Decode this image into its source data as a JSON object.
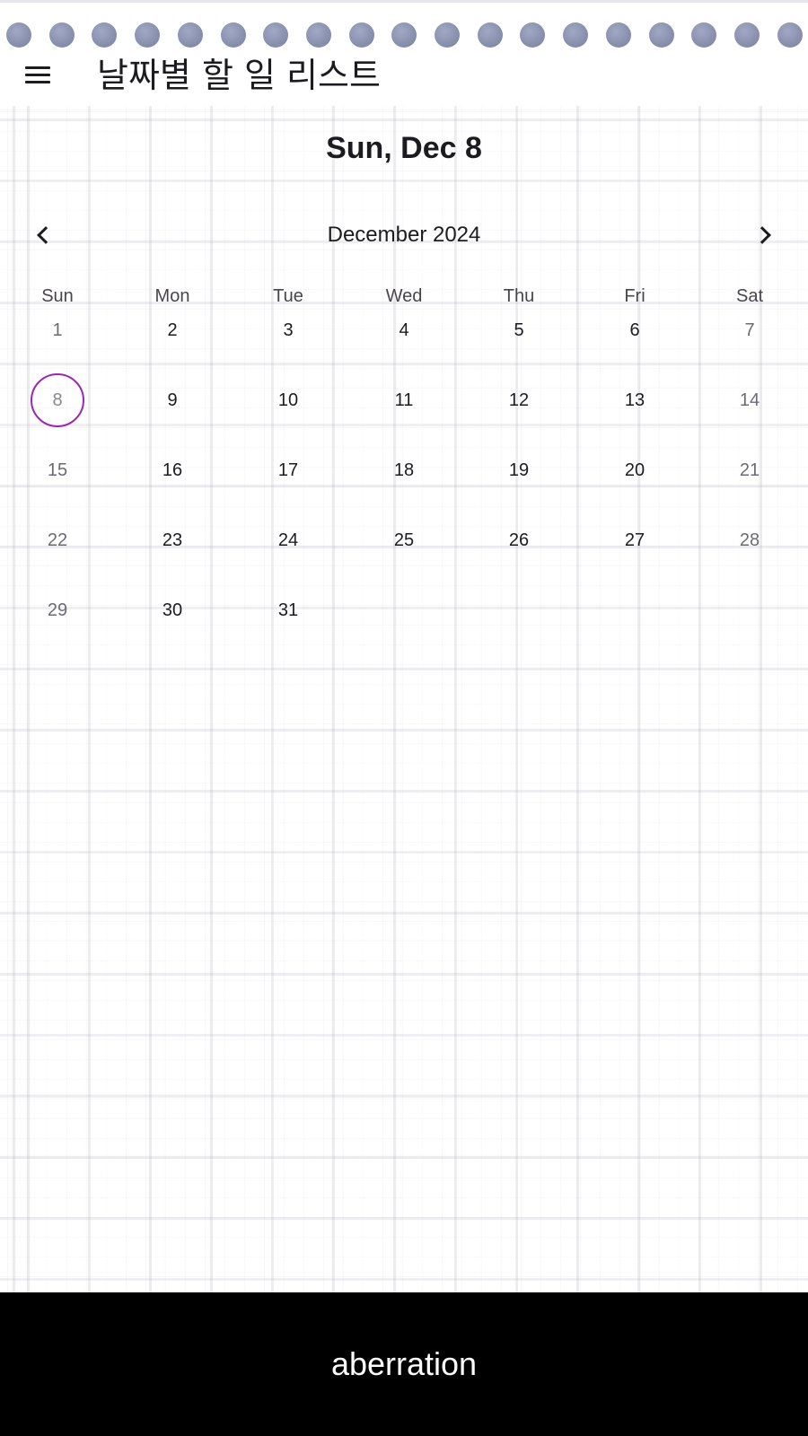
{
  "app_bar": {
    "title": "날짜별 할 일 리스트",
    "menu_icon": "menu-icon"
  },
  "calendar": {
    "selected_date_header": "Sun, Dec 8",
    "month_label": "December 2024",
    "prev_icon": "chevron-left-icon",
    "next_icon": "chevron-right-icon",
    "weekdays": [
      "Sun",
      "Mon",
      "Tue",
      "Wed",
      "Thu",
      "Fri",
      "Sat"
    ],
    "weeks": [
      [
        "1",
        "2",
        "3",
        "4",
        "5",
        "6",
        "7"
      ],
      [
        "8",
        "9",
        "10",
        "11",
        "12",
        "13",
        "14"
      ],
      [
        "15",
        "16",
        "17",
        "18",
        "19",
        "20",
        "21"
      ],
      [
        "22",
        "23",
        "24",
        "25",
        "26",
        "27",
        "28"
      ],
      [
        "29",
        "30",
        "31",
        "",
        "",
        "",
        ""
      ]
    ],
    "selected_day": "8",
    "accent_color": "#9c27b0"
  },
  "bottom_bar": {
    "text": "aberration"
  }
}
